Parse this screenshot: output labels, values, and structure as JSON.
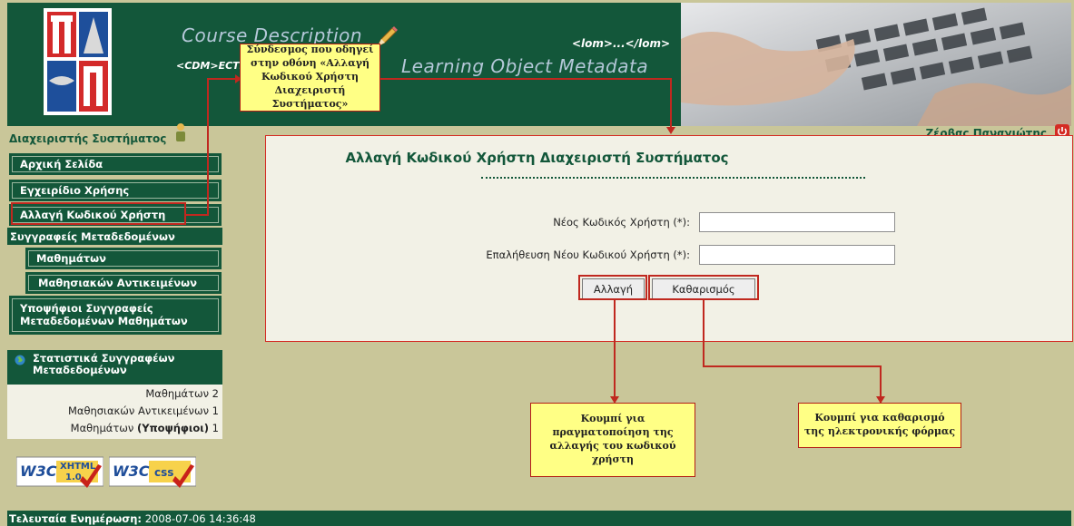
{
  "header": {
    "course_title": "Course Description",
    "cdm_text": "<CDM>ECTS",
    "lom_text": "<lom>...</lom>",
    "lo_title": "Learning Object Metadata"
  },
  "role": {
    "title": "Διαχειριστής Συστήματος"
  },
  "user": {
    "name": "Ζέρβας Παναγιώτης"
  },
  "nav": {
    "home": "Αρχική Σελίδα",
    "manual": "Εγχειρίδιο Χρήσης",
    "change_password": "Αλλαγή Κωδικού Χρήστη",
    "authors_group": "Συγγραφείς Μεταδεδομένων",
    "courses": "Μαθημάτων",
    "learning_objects": "Μαθησιακών Αντικειμένων",
    "candidates": "Υποψήφιοι Συγγραφείς Μεταδεδομένων Μαθημάτων"
  },
  "stats": {
    "title": "Στατιστικά Συγγραφέων Μεταδεδομένων",
    "rows": [
      {
        "label": "Μαθημάτων",
        "value": "2"
      },
      {
        "label": "Μαθησιακών Αντικειμένων",
        "value": "1"
      },
      {
        "label": "Μαθημάτων",
        "label_bold": "(Υποψήφιοι)",
        "value": "1"
      }
    ]
  },
  "badges": {
    "xhtml": "XHTML",
    "xhtml_version": "1.0",
    "css": "css",
    "w3c": "W3C"
  },
  "footer": {
    "label": "Τελευταία Ενημέρωση:",
    "value": "2008-07-06 14:36:48"
  },
  "form": {
    "title": "Αλλαγή Κωδικού Χρήστη Διαχειριστή Συστήματος",
    "new_password_label": "Νέος Κωδικός Χρήστη (*):",
    "confirm_password_label": "Επαλήθευση Νέου Κωδικού Χρήστη (*):",
    "new_password_value": "",
    "confirm_password_value": "",
    "submit_label": "Αλλαγή",
    "reset_label": "Καθαρισμός"
  },
  "callouts": {
    "link": "Σύνδεσμος που οδηγεί\nστην οθόνη «Αλλαγή\nΚωδικού Χρήστη\nΔιαχειριστή Συστήματος»",
    "submit": "Κουμπί για\nπραγματοποίηση της\nαλλαγής του κωδικού\nχρήστη",
    "reset": "Κουμπί για καθαρισμό\nτης ηλεκτρονικής φόρμας"
  },
  "colors": {
    "green": "#13573a",
    "khaki": "#c9c699",
    "panel": "#f2f1e6",
    "callout": "#ffff85",
    "annotation_red": "#c0281f"
  },
  "icons": {
    "role": "user-icon",
    "logout": "power-icon",
    "stats": "globe-icon",
    "pencil": "pencil-icon"
  }
}
